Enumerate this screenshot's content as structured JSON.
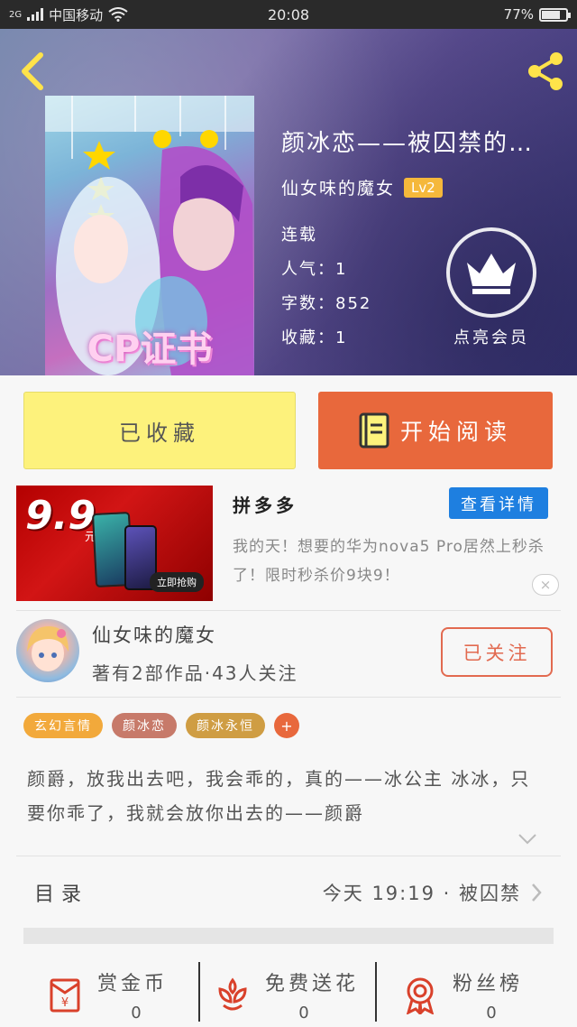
{
  "status_bar": {
    "network": "2G",
    "carrier": "中国移动",
    "time": "20:08",
    "battery": "77%",
    "battery_level": 0.77
  },
  "book": {
    "title": "颜冰恋——被囚禁的…",
    "author": "仙女味的魔女",
    "author_level": "Lv2",
    "status": "连载",
    "popularity": "人气：1",
    "word_count": "字数：852",
    "favorites": "收藏：1",
    "cover_text": "CP证书"
  },
  "vip": {
    "label": "点亮会员"
  },
  "actions": {
    "collected": "已收藏",
    "read": "开始阅读"
  },
  "ad": {
    "price": "9.9",
    "price_unit": "元",
    "buy_label": "立即抢购",
    "brand": "拼多多",
    "detail_button": "查看详情",
    "description": "我的天！想要的华为nova5 Pro居然上秒杀了！限时秒杀价9块9！",
    "close": "×"
  },
  "author_card": {
    "name": "仙女味的魔女",
    "meta": "著有2部作品·43人关注",
    "follow": "已关注"
  },
  "tags": [
    {
      "label": "玄幻言情",
      "color": "#f2a93b"
    },
    {
      "label": "颜冰恋",
      "color": "#c77a6a"
    },
    {
      "label": "颜冰永恒",
      "color": "#cf9d43"
    }
  ],
  "tag_add": "+",
  "summary": "颜爵，放我出去吧，我会乖的，真的——冰公主 冰冰，只要你乖了，我就会放你出去的——颜爵",
  "toc": {
    "label": "目录",
    "latest": "今天 19:19 · 被囚禁"
  },
  "bottom": {
    "reward": {
      "label": "赏金币",
      "count": "0"
    },
    "flowers": {
      "label": "免费送花",
      "count": "0"
    },
    "fans": {
      "label": "粉丝榜",
      "count": "0"
    }
  },
  "colors": {
    "accent_orange": "#e8683c",
    "collected_yellow": "#fdf27c",
    "level_badge": "#f5b83b",
    "detail_blue": "#1e7fe0",
    "icon_red": "#d9412b"
  }
}
